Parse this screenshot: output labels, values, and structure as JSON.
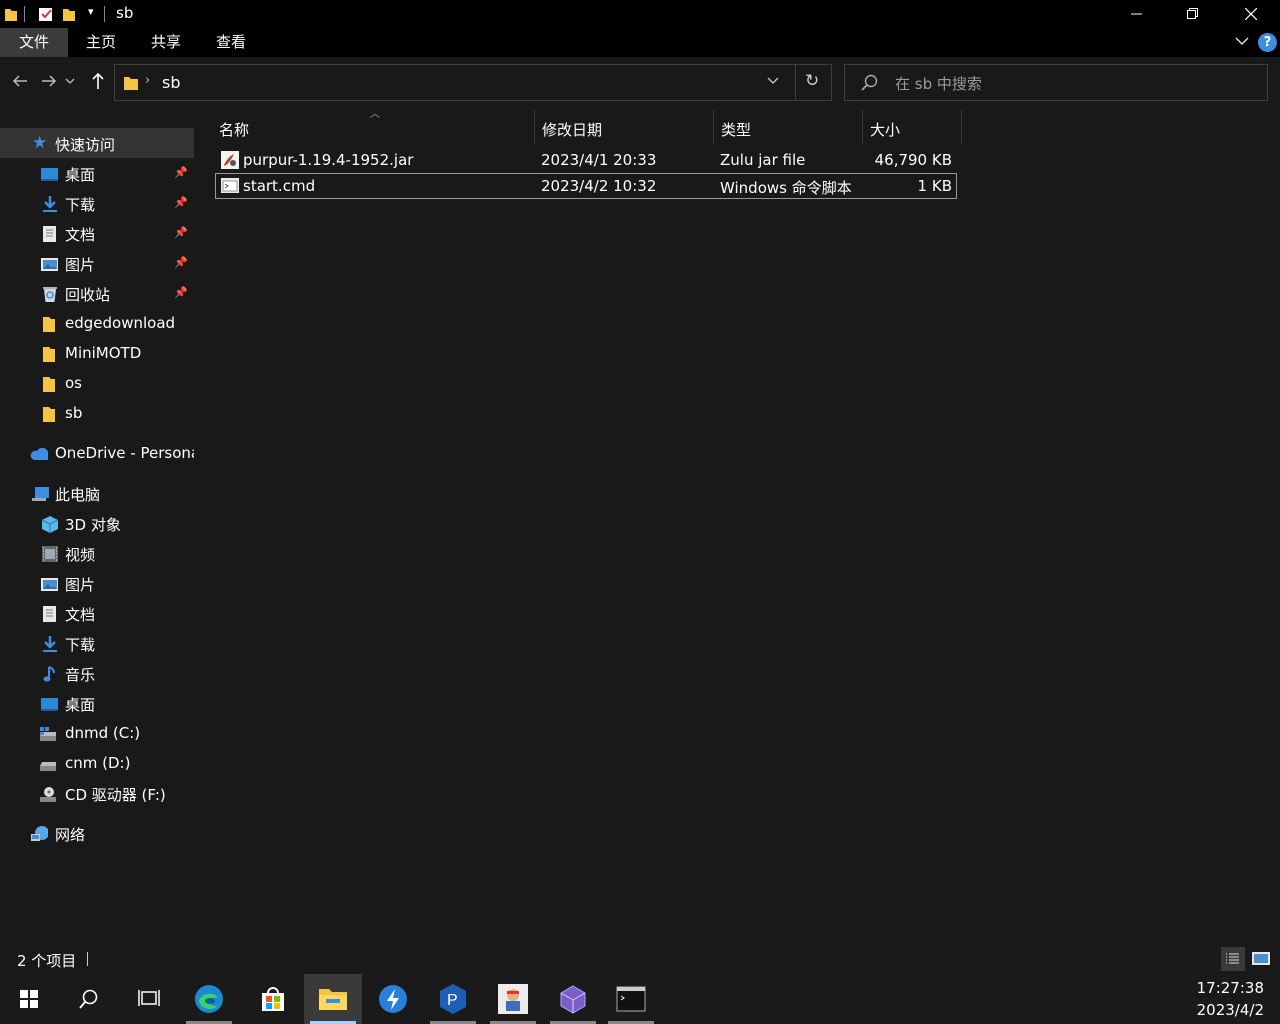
{
  "window": {
    "title": "sb",
    "quick_access_dropdown": "▾"
  },
  "ribbon": {
    "tabs": [
      "文件",
      "主页",
      "共享",
      "查看"
    ],
    "help": "?"
  },
  "address": {
    "path": "sb",
    "separator": "›"
  },
  "search": {
    "placeholder": "在 sb 中搜索"
  },
  "sidebar": {
    "quick_access": "快速访问",
    "quick_items": [
      {
        "label": "桌面",
        "pinned": true,
        "icon": "desktop-icon"
      },
      {
        "label": "下载",
        "pinned": true,
        "icon": "download-icon"
      },
      {
        "label": "文档",
        "pinned": true,
        "icon": "document-icon"
      },
      {
        "label": "图片",
        "pinned": true,
        "icon": "picture-icon"
      },
      {
        "label": "回收站",
        "pinned": true,
        "icon": "recycle-bin-icon"
      },
      {
        "label": "edgedownload",
        "pinned": false,
        "icon": "folder-icon"
      },
      {
        "label": "MiniMOTD",
        "pinned": false,
        "icon": "folder-icon"
      },
      {
        "label": "os",
        "pinned": false,
        "icon": "folder-icon"
      },
      {
        "label": "sb",
        "pinned": false,
        "icon": "folder-icon"
      }
    ],
    "onedrive": "OneDrive - Persona",
    "this_pc": "此电脑",
    "pc_items": [
      {
        "label": "3D 对象",
        "icon": "3d-objects-icon"
      },
      {
        "label": "视频",
        "icon": "video-icon"
      },
      {
        "label": "图片",
        "icon": "picture-icon"
      },
      {
        "label": "文档",
        "icon": "document-icon"
      },
      {
        "label": "下载",
        "icon": "download-icon"
      },
      {
        "label": "音乐",
        "icon": "music-icon"
      },
      {
        "label": "桌面",
        "icon": "desktop-icon"
      },
      {
        "label": "dnmd (C:)",
        "icon": "drive-c-icon"
      },
      {
        "label": "cnm (D:)",
        "icon": "drive-d-icon"
      },
      {
        "label": "CD 驱动器 (F:)",
        "icon": "cd-drive-icon"
      }
    ],
    "network": "网络"
  },
  "columns": {
    "name": "名称",
    "modified": "修改日期",
    "type": "类型",
    "size": "大小"
  },
  "files": [
    {
      "name": "purpur-1.19.4-1952.jar",
      "modified": "2023/4/1 20:33",
      "type": "Zulu jar file",
      "size": "46,790 KB"
    },
    {
      "name": "start.cmd",
      "modified": "2023/4/2 10:32",
      "type": "Windows 命令脚本",
      "size": "1 KB"
    }
  ],
  "status": {
    "count": "2 个项目"
  },
  "clock": {
    "time": "17:27:38",
    "date": "2023/4/2"
  },
  "colors": {
    "folder": "#f4c542",
    "accent": "#3d8ee0"
  }
}
